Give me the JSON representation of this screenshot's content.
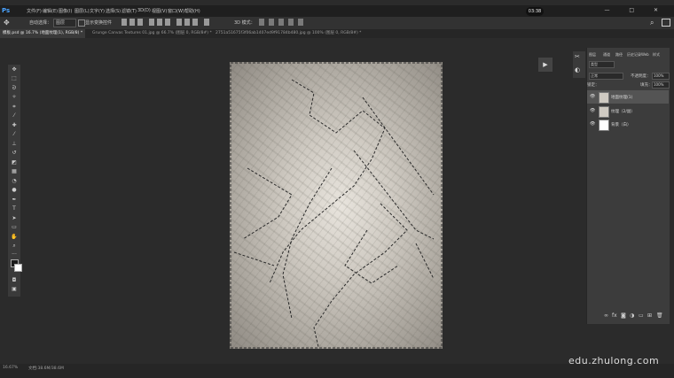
{
  "menubar": {
    "app_logo": "Ps",
    "items": [
      "文件(F)",
      "编辑(E)",
      "图像(I)",
      "图层(L)",
      "文字(Y)",
      "选择(S)",
      "滤镜(T)",
      "3D(D)",
      "视图(V)",
      "窗口(W)",
      "帮助(H)"
    ],
    "clock": "03:38",
    "window_controls": "— □ ✕"
  },
  "options": {
    "auto_select_label": "自动选择：",
    "auto_select_value": "图层",
    "transform_label": "显示变换控件",
    "mode_label": "3D 模式："
  },
  "tabs": [
    {
      "label": "模板.psd @ 16.7% (地面纹理(1), RGB/8) *",
      "active": true
    },
    {
      "label": "Grunge Canvas Textures 01.jpg @ 66.7% (图层 0, RGB/8#) *",
      "active": false
    },
    {
      "label": "2751a51675f3f06ab1407ed9f91784b480.jpg @ 100% (图层 0, RGB/8#) *",
      "active": false
    }
  ],
  "layers_panel": {
    "tabs": [
      "图层",
      "通道",
      "路径",
      "历史记录",
      "Web",
      "样式"
    ],
    "filter_label": "类型",
    "blend_mode": "正常",
    "opacity_label": "不透明度：",
    "opacity_value": "100%",
    "lock_label": "锁定：",
    "fill_label": "填充：",
    "fill_value": "100%",
    "layers": [
      {
        "name": "地面纹理(1)",
        "selected": true
      },
      {
        "name": "纹理（2/副）",
        "selected": false
      },
      {
        "name": "背景（白）",
        "selected": false
      }
    ]
  },
  "statusbar": {
    "zoom": "16.67%",
    "doc_info": "文档:38.6M/38.6M"
  },
  "watermark": "edu.zhulong.com"
}
